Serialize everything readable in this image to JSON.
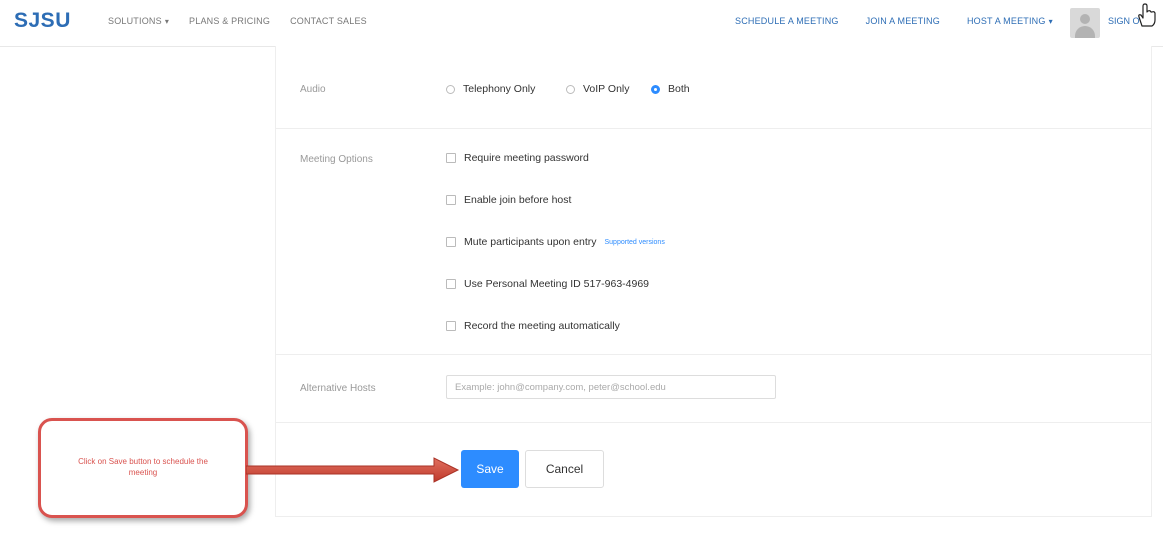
{
  "brand": {
    "logo_text": "SJSU",
    "color": "#2d6db5"
  },
  "nav": {
    "left": [
      {
        "label": "SOLUTIONS",
        "dropdown": true
      },
      {
        "label": "PLANS & PRICING",
        "dropdown": false
      },
      {
        "label": "CONTACT SALES",
        "dropdown": false
      }
    ],
    "right": [
      {
        "label": "SCHEDULE A MEETING",
        "dropdown": false
      },
      {
        "label": "JOIN A MEETING",
        "dropdown": false
      },
      {
        "label": "HOST A MEETING",
        "dropdown": true
      }
    ],
    "sign_out": "SIGN OUT",
    "caret": "▾"
  },
  "form": {
    "audio": {
      "label": "Audio",
      "options": [
        {
          "label": "Telephony Only",
          "selected": false
        },
        {
          "label": "VoIP Only",
          "selected": false
        },
        {
          "label": "Both",
          "selected": true
        }
      ]
    },
    "meeting_options": {
      "label": "Meeting Options",
      "items": [
        {
          "label": "Require meeting password",
          "checked": false
        },
        {
          "label": "Enable join before host",
          "checked": false
        },
        {
          "label": "Mute participants upon entry",
          "checked": false,
          "link": "Supported versions"
        },
        {
          "label": "Use Personal Meeting ID 517-963-4969",
          "checked": false
        },
        {
          "label": "Record the meeting automatically",
          "checked": false
        }
      ]
    },
    "alternative_hosts": {
      "label": "Alternative Hosts",
      "value": "",
      "placeholder": "Example: john@company.com, peter@school.edu"
    },
    "buttons": {
      "save": "Save",
      "cancel": "Cancel"
    }
  },
  "callout": {
    "text": "Click on Save button to schedule the meeting"
  },
  "colors": {
    "accent": "#2d8cff",
    "callout_red": "#d9534f"
  }
}
